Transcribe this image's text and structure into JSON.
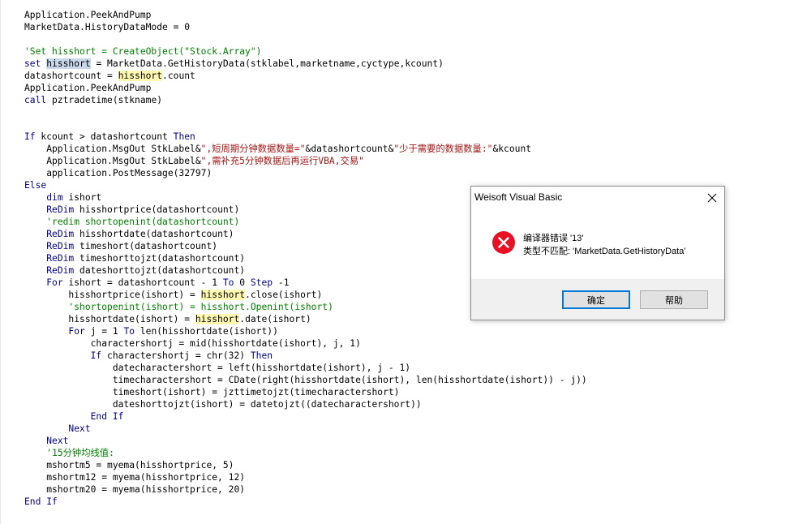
{
  "code": {
    "lines": [
      [
        [
          "plain",
          "Application.PeekAndPump"
        ]
      ],
      [
        [
          "plain",
          "MarketData.HistoryDataMode = 0"
        ]
      ],
      [
        [
          "plain",
          ""
        ]
      ],
      [
        [
          "cm",
          "'Set hisshort = CreateObject(\"Stock.Array\")"
        ]
      ],
      [
        [
          "kw",
          "set"
        ],
        [
          "plain",
          " "
        ],
        [
          "sel",
          "hisshort"
        ],
        [
          "plain",
          " = MarketData.GetHistoryData(stklabel,marketname,cyctype,kcount)"
        ]
      ],
      [
        [
          "plain",
          "datashortcount = "
        ],
        [
          "hl",
          "hisshort"
        ],
        [
          "plain",
          ".count"
        ]
      ],
      [
        [
          "plain",
          "Application.PeekAndPump"
        ]
      ],
      [
        [
          "kw",
          "call"
        ],
        [
          "plain",
          " pztradetime(stkname)"
        ]
      ],
      [
        [
          "plain",
          ""
        ]
      ],
      [
        [
          "plain",
          ""
        ]
      ],
      [
        [
          "kw",
          "If"
        ],
        [
          "plain",
          " kcount > datashortcount "
        ],
        [
          "kw",
          "Then"
        ]
      ],
      [
        [
          "plain",
          "    Application.MsgOut StkLabel&"
        ],
        [
          "str",
          "\",短周期分钟数据数量=\""
        ],
        [
          "plain",
          "&datashortcount&"
        ],
        [
          "str",
          "\"少于需要的数据数量:\""
        ],
        [
          "plain",
          "&kcount"
        ]
      ],
      [
        [
          "plain",
          "    Application.MsgOut StkLabel&"
        ],
        [
          "str",
          "\",需补充5分钟数据后再运行VBA,交易\""
        ]
      ],
      [
        [
          "plain",
          "    application.PostMessage(32797)"
        ]
      ],
      [
        [
          "kw",
          "Else"
        ]
      ],
      [
        [
          "plain",
          "    "
        ],
        [
          "kw",
          "dim"
        ],
        [
          "plain",
          " ishort"
        ]
      ],
      [
        [
          "plain",
          "    "
        ],
        [
          "kw",
          "ReDim"
        ],
        [
          "plain",
          " hisshortprice(datashortcount)"
        ]
      ],
      [
        [
          "plain",
          "    "
        ],
        [
          "cm",
          "'redim shortopenint(datashortcount)"
        ]
      ],
      [
        [
          "plain",
          "    "
        ],
        [
          "kw",
          "ReDim"
        ],
        [
          "plain",
          " hisshortdate(datashortcount)"
        ]
      ],
      [
        [
          "plain",
          "    "
        ],
        [
          "kw",
          "ReDim"
        ],
        [
          "plain",
          " timeshort(datashortcount)"
        ]
      ],
      [
        [
          "plain",
          "    "
        ],
        [
          "kw",
          "ReDim"
        ],
        [
          "plain",
          " timeshorttojzt(datashortcount)"
        ]
      ],
      [
        [
          "plain",
          "    "
        ],
        [
          "kw",
          "ReDim"
        ],
        [
          "plain",
          " dateshorttojzt(datashortcount)"
        ]
      ],
      [
        [
          "plain",
          "    "
        ],
        [
          "kw",
          "For"
        ],
        [
          "plain",
          " ishort = datashortcount - 1 "
        ],
        [
          "kw",
          "To"
        ],
        [
          "plain",
          " 0 "
        ],
        [
          "kw",
          "Step"
        ],
        [
          "plain",
          " -1"
        ]
      ],
      [
        [
          "plain",
          "        hisshortprice(ishort) = "
        ],
        [
          "hl",
          "hisshort"
        ],
        [
          "plain",
          ".close(ishort)"
        ]
      ],
      [
        [
          "plain",
          "        "
        ],
        [
          "cm",
          "'shortopenint(ishort) = hisshort.Openint(ishort)"
        ]
      ],
      [
        [
          "plain",
          "        hisshortdate(ishort) = "
        ],
        [
          "hl",
          "hisshort"
        ],
        [
          "plain",
          ".date(ishort)"
        ]
      ],
      [
        [
          "plain",
          "        "
        ],
        [
          "kw",
          "For"
        ],
        [
          "plain",
          " j = 1 "
        ],
        [
          "kw",
          "To"
        ],
        [
          "plain",
          " len(hisshortdate(ishort))"
        ]
      ],
      [
        [
          "plain",
          "            charactershortj = mid(hisshortdate(ishort), j, 1)"
        ]
      ],
      [
        [
          "plain",
          "            "
        ],
        [
          "kw",
          "If"
        ],
        [
          "plain",
          " charactershortj = chr(32) "
        ],
        [
          "kw",
          "Then"
        ]
      ],
      [
        [
          "plain",
          "                datecharactershort = left(hisshortdate(ishort), j - 1)"
        ]
      ],
      [
        [
          "plain",
          "                timecharactershort = CDate(right(hisshortdate(ishort), len(hisshortdate(ishort)) - j))"
        ]
      ],
      [
        [
          "plain",
          "                timeshort(ishort) = jzttimetojzt(timecharactershort)"
        ]
      ],
      [
        [
          "plain",
          "                dateshorttojzt(ishort) = datetojzt((datecharactershort))"
        ]
      ],
      [
        [
          "plain",
          "            "
        ],
        [
          "kw",
          "End If"
        ]
      ],
      [
        [
          "plain",
          "        "
        ],
        [
          "kw",
          "Next"
        ]
      ],
      [
        [
          "plain",
          "    "
        ],
        [
          "kw",
          "Next"
        ]
      ],
      [
        [
          "plain",
          "    "
        ],
        [
          "cm",
          "'15分钟均线值:"
        ]
      ],
      [
        [
          "plain",
          "    mshortm5 = myema(hisshortprice, 5)"
        ]
      ],
      [
        [
          "plain",
          "    mshortm12 = myema(hisshortprice, 12)"
        ]
      ],
      [
        [
          "plain",
          "    mshortm20 = myema(hisshortprice, 20)"
        ]
      ],
      [
        [
          "kw",
          "End If"
        ]
      ]
    ]
  },
  "dialog": {
    "title": "Weisoft Visual Basic",
    "message_line1": "编译器错误 '13'",
    "message_line2": "类型不匹配: 'MarketData.GetHistoryData'",
    "ok_label": "确定",
    "help_label": "帮助",
    "icon": "error-icon",
    "close_icon": "close-icon"
  },
  "colors": {
    "keyword": "#00008b",
    "comment": "#008000",
    "string": "#a31515",
    "highlight": "#fff8b0",
    "selection": "#c8d7ea",
    "error_red": "#e81123"
  }
}
